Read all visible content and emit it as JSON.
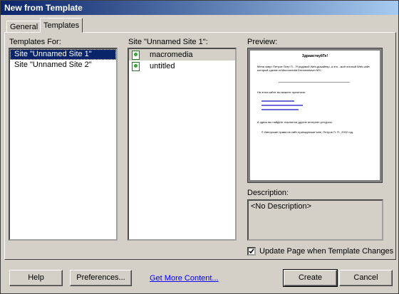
{
  "window": {
    "title": "New from Template"
  },
  "tabs": [
    {
      "label": "General"
    },
    {
      "label": "Templates"
    }
  ],
  "templates_for": {
    "label": "Templates For:",
    "items": [
      {
        "label": "Site \"Unnamed Site 1\""
      },
      {
        "label": "Site \"Unnamed Site 2\""
      }
    ],
    "selected_index": 0
  },
  "site_list": {
    "label": "Site \"Unnamed Site 1\":",
    "items": [
      {
        "label": "macromedia",
        "icon": "template-file-icon"
      },
      {
        "label": "untitled",
        "icon": "template-file-icon"
      }
    ]
  },
  "preview": {
    "label": "Preview:",
    "page_title": "ЗдравствуйТе!",
    "page_text_1": "Меня зовут Петров Петр П... Я рядовой Web-дизайнер, а это - мой личный Web-сайт, который сделан в Macromedia Dreamweaver MX.",
    "page_text_2": "На этом сайте вы можете прочитать:",
    "page_text_3": "А здесь вы найдете ссылки на другие интернет-ресурсы.",
    "page_text_4": "© Авторские права на сайт принадлежат мне, Петров П. П., 2002 год."
  },
  "description": {
    "label": "Description:",
    "value": "<No Description>"
  },
  "update_checkbox": {
    "label": "Update Page when Template Changes",
    "checked": true
  },
  "buttons": {
    "help": "Help",
    "preferences": "Preferences...",
    "get_more": "Get More Content...",
    "create": "Create",
    "cancel": "Cancel"
  }
}
